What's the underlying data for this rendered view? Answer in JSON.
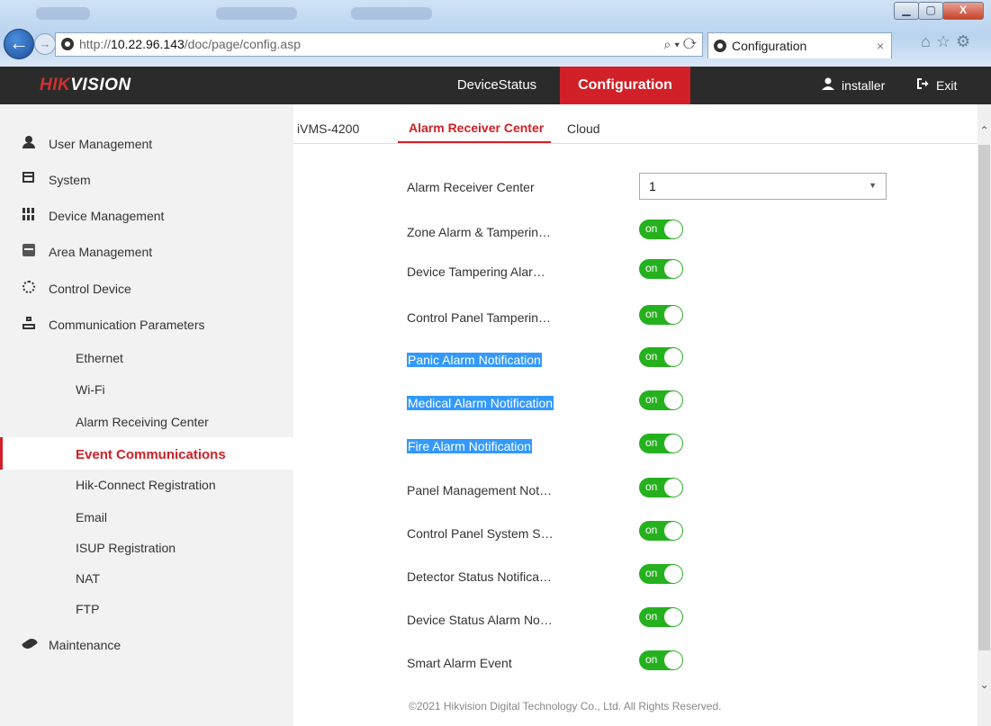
{
  "browser": {
    "url_prefix": "http://",
    "url_host": "10.22.96.143",
    "url_path": "/doc/page/config.asp",
    "address_tools": "⌕ ▾ ⟳",
    "tab_title": "Configuration",
    "tab_close": "×",
    "window_buttons": [
      "▁",
      "▢",
      "X"
    ],
    "toolbar_icons": "⌂☆⚙"
  },
  "header": {
    "logo_hik": "HIK",
    "logo_rest": "VISION",
    "nav": [
      "DeviceStatus",
      "Configuration"
    ],
    "user": "installer",
    "exit": "Exit",
    "accent": "#d12027"
  },
  "sidebar": {
    "items": [
      {
        "label": "User Management",
        "icon": "user-icon"
      },
      {
        "label": "System",
        "icon": "system-icon"
      },
      {
        "label": "Device Management",
        "icon": "device-icon"
      },
      {
        "label": "Area Management",
        "icon": "area-icon"
      },
      {
        "label": "Control Device",
        "icon": "control-icon"
      },
      {
        "label": "Communication Parameters",
        "icon": "network-icon"
      },
      {
        "label": "Ethernet"
      },
      {
        "label": "Wi-Fi"
      },
      {
        "label": "Alarm Receiving Center"
      },
      {
        "label": "Event Communications",
        "active": true
      },
      {
        "label": "Hik-Connect Registration"
      },
      {
        "label": "Email"
      },
      {
        "label": "ISUP Registration"
      },
      {
        "label": "NAT"
      },
      {
        "label": "FTP"
      },
      {
        "label": "Maintenance",
        "icon": "wrench-icon"
      }
    ]
  },
  "main": {
    "tabs": [
      "iVMS-4200",
      "Alarm Receiver Center",
      "Cloud"
    ],
    "active_tab": "Alarm Receiver Center",
    "select_label": "Alarm Receiver Center",
    "select_value": "1",
    "toggle_text": "on",
    "toggle_color": "#25b11e",
    "rows": [
      {
        "label": "Zone Alarm & Tamperin…",
        "state": "on"
      },
      {
        "label": "Device Tampering Alar…",
        "state": "on"
      },
      {
        "label": "Control Panel Tamperin…",
        "state": "on"
      },
      {
        "label": "Panic Alarm Notification",
        "state": "on",
        "highlighted": true
      },
      {
        "label": "Medical Alarm Notification",
        "state": "on",
        "highlighted": true
      },
      {
        "label": "Fire Alarm Notification",
        "state": "on",
        "highlighted": true
      },
      {
        "label": "Panel Management Not…",
        "state": "on"
      },
      {
        "label": "Control Panel System S…",
        "state": "on"
      },
      {
        "label": "Detector Status Notifica…",
        "state": "on"
      },
      {
        "label": "Device Status Alarm No…",
        "state": "on"
      },
      {
        "label": "Smart Alarm Event",
        "state": "on"
      }
    ],
    "footer": "©2021 Hikvision Digital Technology Co., Ltd. All Rights Reserved."
  }
}
